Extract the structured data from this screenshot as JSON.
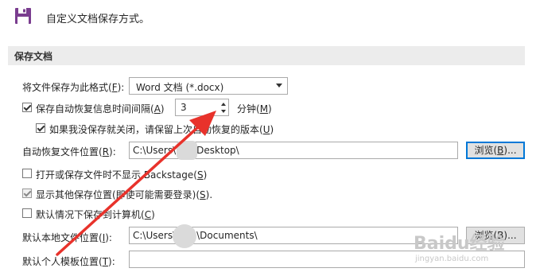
{
  "header": {
    "icon": "floppy-disk-icon",
    "title": "自定义文档保存方式。"
  },
  "section": {
    "title": "保存文档"
  },
  "format": {
    "label": "将文件保存为此格式(",
    "key": "F",
    "suffix": "):",
    "value": "Word 文档 (*.docx)"
  },
  "autorecover": {
    "label": "保存自动恢复信息时间间隔(",
    "key": "A",
    "suffix": ")",
    "value": "3",
    "unit_label": "分钟(",
    "unit_key": "M",
    "unit_suffix": ")",
    "checked": true
  },
  "keep_last": {
    "label": "如果我没保存就关闭，请保留上次自动恢复的版本(",
    "key": "U",
    "suffix": ")",
    "checked": true
  },
  "recover_path": {
    "label": "自动恢复文件位置(",
    "key": "R",
    "suffix": "):",
    "value_a": "C:\\Users\\",
    "value_b": "\\Desktop\\",
    "browse": "浏览(",
    "browse_key": "B",
    "browse_suffix": ")..."
  },
  "no_backstage": {
    "label": "打开或保存文件时不显示 Backstage(",
    "key": "S",
    "suffix": ")",
    "checked": false
  },
  "show_more": {
    "label": "显示其他保存位置(即使可能需要登录)(",
    "key": "S",
    "suffix": ").",
    "checked": true
  },
  "save_computer": {
    "label": "默认情况下保存到计算机(",
    "key": "C",
    "suffix": ")",
    "checked": false
  },
  "local_path": {
    "label": "默认本地文件位置(",
    "key": "I",
    "suffix": "):",
    "value_a": "C:\\Users\\",
    "value_b": "\\Documents\\",
    "browse": "浏览(",
    "browse_key": "B",
    "browse_suffix": ")..."
  },
  "template_path": {
    "label": "默认个人模板位置(",
    "key": "T",
    "suffix": "):",
    "value": ""
  },
  "watermark": {
    "main": "Baidu经验",
    "sub": "jingyan.baidu.com"
  },
  "colors": {
    "annotation_arrow": "#e8322b",
    "focus": "#0078d7",
    "header_icon": "#7a3d8f"
  }
}
